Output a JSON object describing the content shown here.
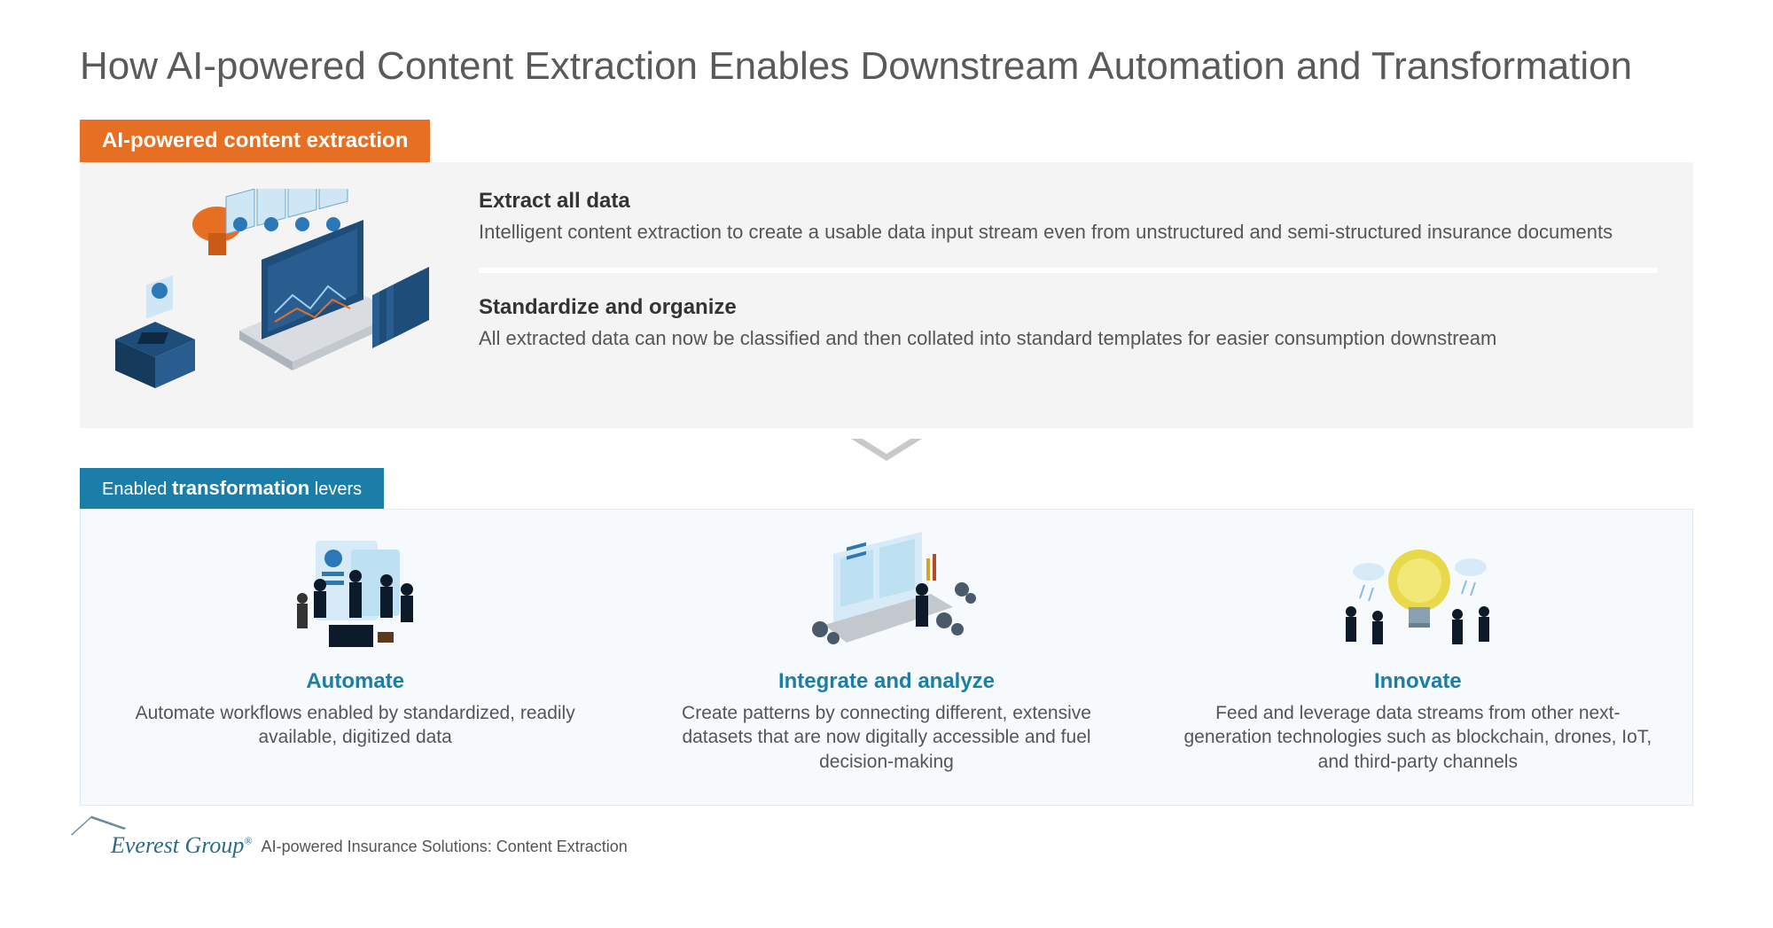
{
  "title": "How AI-powered Content Extraction Enables Downstream Automation and Transformation",
  "section1": {
    "tag": "AI-powered content extraction",
    "blocks": [
      {
        "title": "Extract all data",
        "desc": "Intelligent content extraction to create a usable data input stream even from unstructured and semi-structured insurance documents"
      },
      {
        "title": "Standardize and organize",
        "desc": "All extracted data can now be classified and then collated into standard templates for easier consumption downstream"
      }
    ]
  },
  "section2": {
    "tag_pre": "Enabled ",
    "tag_bold": "transformation",
    "tag_post": " levers",
    "levers": [
      {
        "title": "Automate",
        "desc": "Automate workflows enabled by standardized, readily available, digitized data"
      },
      {
        "title": "Integrate and analyze",
        "desc": "Create patterns by connecting different, extensive datasets that are now digitally accessible and fuel decision-making"
      },
      {
        "title": "Innovate",
        "desc": "Feed and leverage data streams from other next-generation technologies such as blockchain, drones, IoT, and third-party channels"
      }
    ]
  },
  "footer": {
    "brand": "Everest Group",
    "mark": "®",
    "caption": "AI-powered Insurance Solutions: Content Extraction"
  }
}
